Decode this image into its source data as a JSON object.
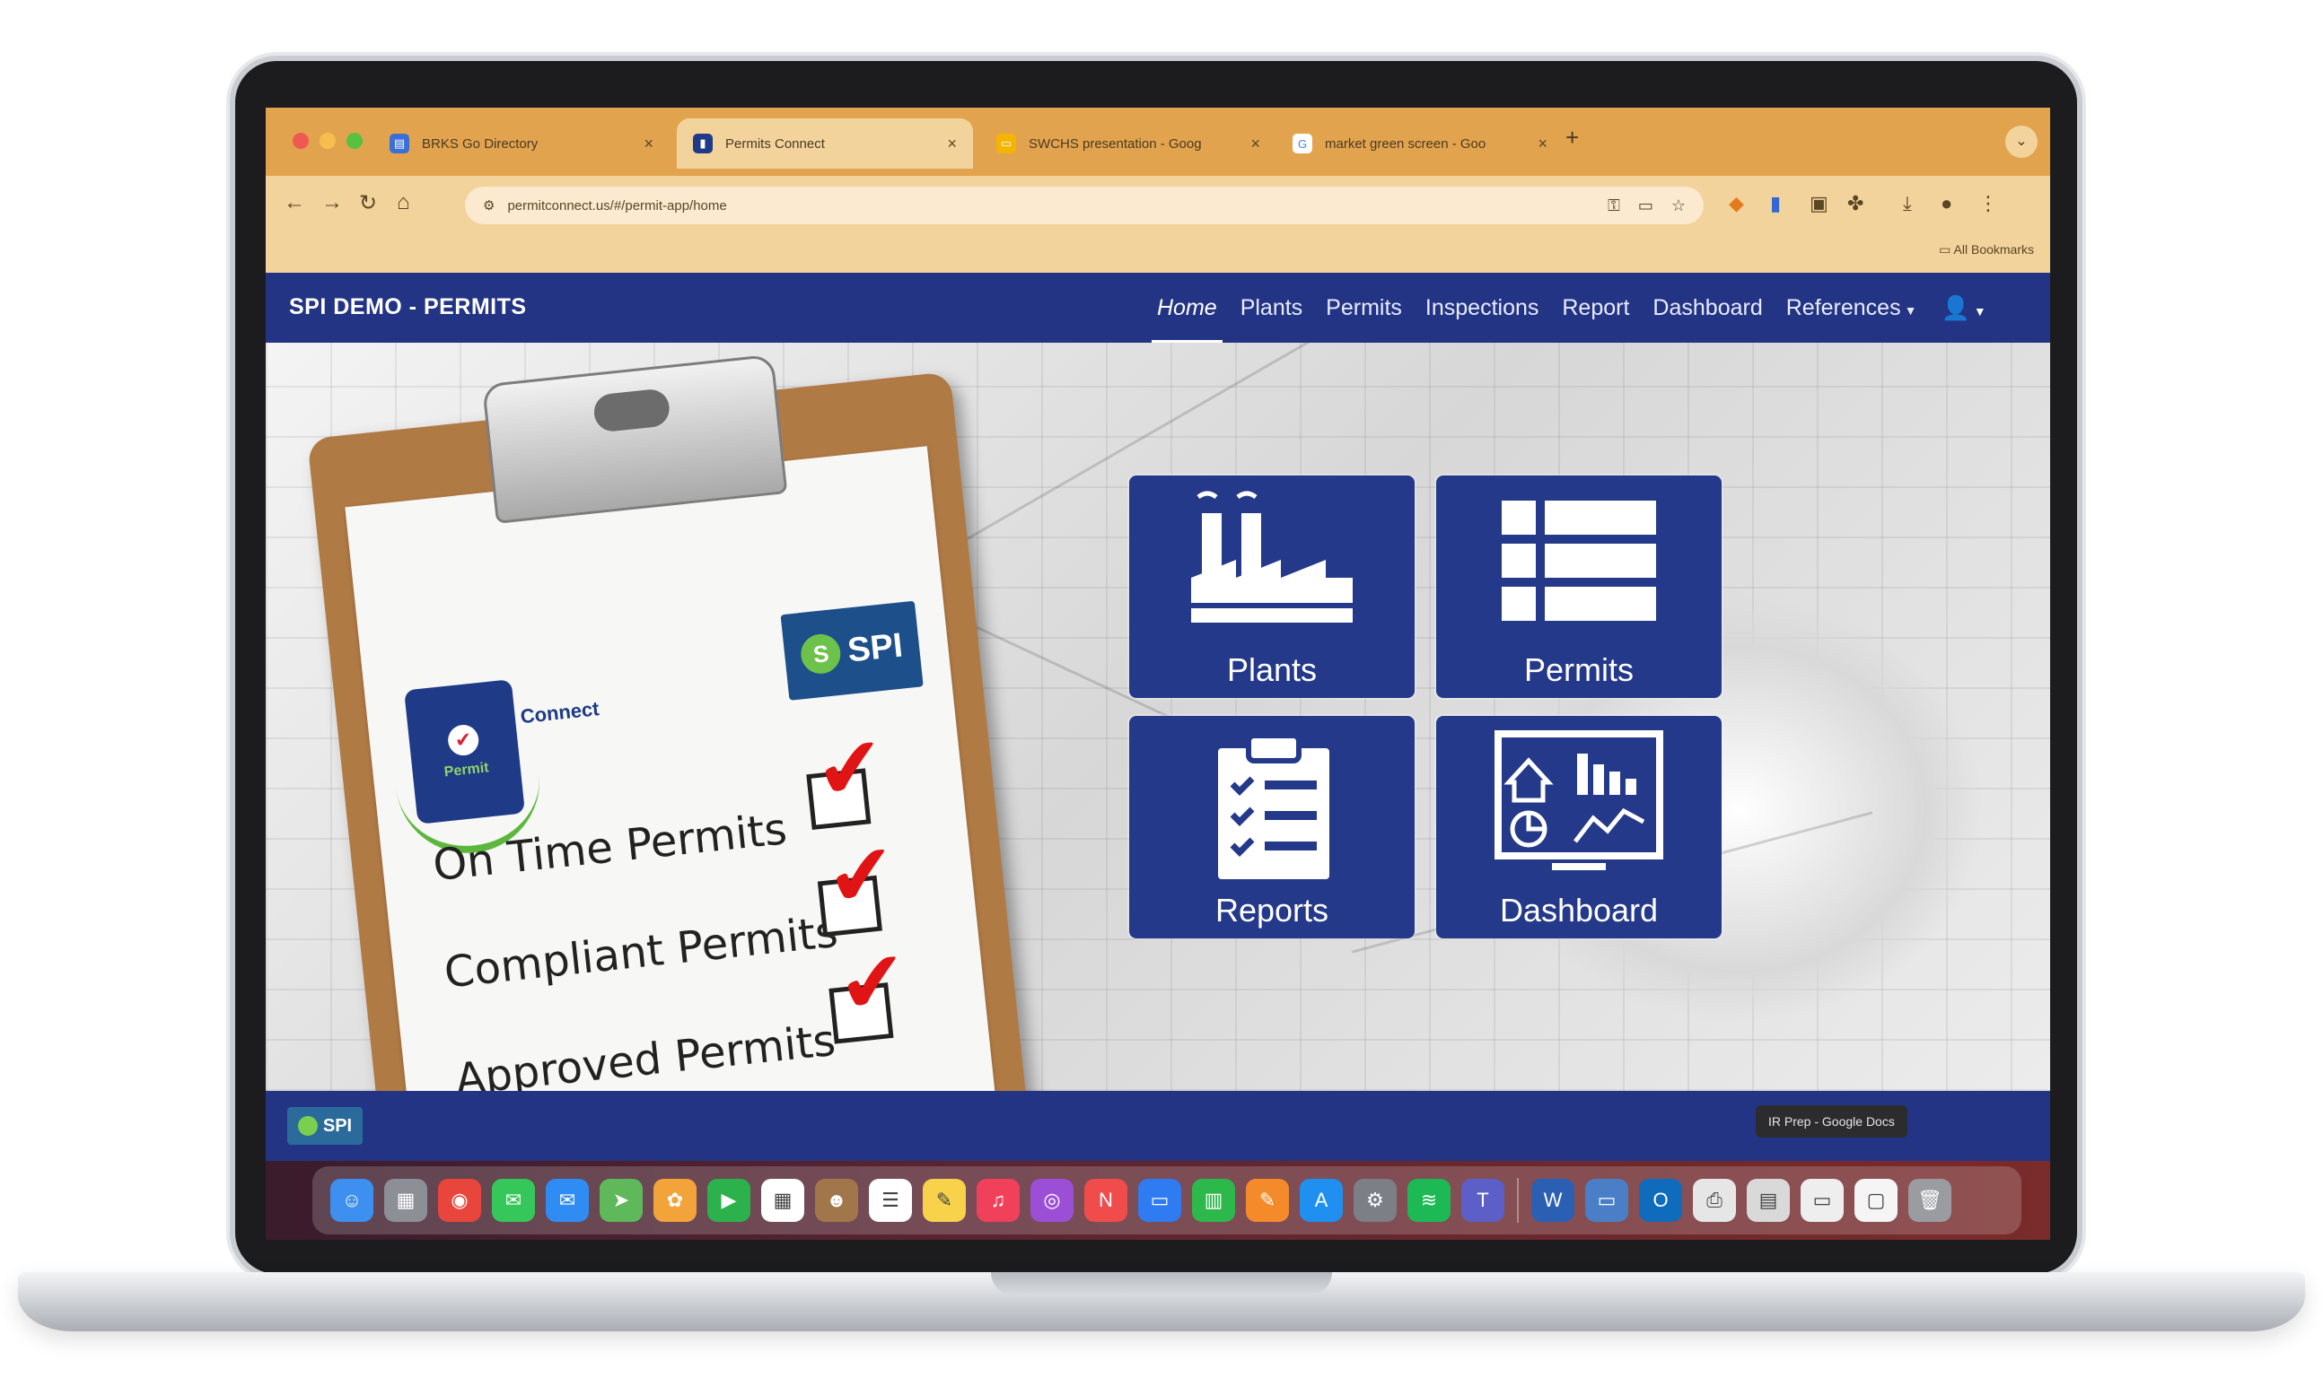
{
  "browser": {
    "tabs": [
      {
        "label": "BRKS Go Directory",
        "color": "#3b6fd6",
        "icon": "doc-icon"
      },
      {
        "label": "Permits Connect",
        "color": "#1f3a86",
        "icon": "permit-icon"
      },
      {
        "label": "SWCHS presentation - Goog",
        "color": "#f4b400",
        "icon": "slides-icon"
      },
      {
        "label": "market green screen - Goo",
        "color": "#ffffff",
        "icon": "google-icon"
      }
    ],
    "url": "permitconnect.us/#/permit-app/home",
    "bookmarks_label": "All Bookmarks"
  },
  "app": {
    "brand": "SPI DEMO - PERMITS",
    "nav": [
      {
        "label": "Home",
        "active": true
      },
      {
        "label": "Plants"
      },
      {
        "label": "Permits"
      },
      {
        "label": "Inspections"
      },
      {
        "label": "Report"
      },
      {
        "label": "Dashboard"
      },
      {
        "label": "References",
        "dropdown": true
      }
    ],
    "user_icon": "user-icon"
  },
  "hero": {
    "clipboard": {
      "logo_left": "Permit",
      "logo_connect": "Connect",
      "logo_right": "SPI",
      "items": [
        "On Time Permits",
        "Compliant Permits",
        "Approved Permits"
      ]
    },
    "tiles": [
      {
        "label": "Plants",
        "icon": "factory-icon"
      },
      {
        "label": "Permits",
        "icon": "list-icon"
      },
      {
        "label": "Reports",
        "icon": "checklist-icon"
      },
      {
        "label": "Dashboard",
        "icon": "monitor-chart-icon"
      }
    ]
  },
  "footer": {
    "logo": "SPI",
    "tooltip": "IR Prep - Google Docs"
  },
  "dock": {
    "apps": [
      {
        "name": "finder-icon",
        "color": "#3d8ff0",
        "glyph": "☺"
      },
      {
        "name": "launchpad-icon",
        "color": "#8d8f96",
        "glyph": "▦"
      },
      {
        "name": "chrome-icon",
        "color": "#e8453c",
        "glyph": "◉"
      },
      {
        "name": "messages-icon",
        "color": "#35c759",
        "glyph": "✉"
      },
      {
        "name": "mail-icon",
        "color": "#2f8cf2",
        "glyph": "✉"
      },
      {
        "name": "maps-icon",
        "color": "#5fb85a",
        "glyph": "➤"
      },
      {
        "name": "photos-icon",
        "color": "#f2a33a",
        "glyph": "✿"
      },
      {
        "name": "facetime-icon",
        "color": "#2bb24c",
        "glyph": "▶"
      },
      {
        "name": "calendar-icon",
        "color": "#ffffff",
        "glyph": "▦"
      },
      {
        "name": "contacts-icon",
        "color": "#a0764a",
        "glyph": "☻"
      },
      {
        "name": "reminders-icon",
        "color": "#ffffff",
        "glyph": "☰"
      },
      {
        "name": "notes-icon",
        "color": "#f7d24a",
        "glyph": "✎"
      },
      {
        "name": "music-icon",
        "color": "#f1405a",
        "glyph": "♫"
      },
      {
        "name": "podcasts-icon",
        "color": "#9b4fd6",
        "glyph": "◎"
      },
      {
        "name": "news-icon",
        "color": "#f14c4c",
        "glyph": "N"
      },
      {
        "name": "keynote-icon",
        "color": "#2f7bf2",
        "glyph": "▭"
      },
      {
        "name": "numbers-icon",
        "color": "#2cb84a",
        "glyph": "▥"
      },
      {
        "name": "pages-icon",
        "color": "#f48a2a",
        "glyph": "✎"
      },
      {
        "name": "app-store-icon",
        "color": "#1f8ff0",
        "glyph": "A"
      },
      {
        "name": "settings-icon",
        "color": "#7d7f86",
        "glyph": "⚙"
      },
      {
        "name": "spotify-icon",
        "color": "#1db954",
        "glyph": "≋"
      },
      {
        "name": "teams-icon",
        "color": "#5b5fc7",
        "glyph": "T"
      },
      {
        "name": "word-icon",
        "color": "#2b5fb3",
        "glyph": "W"
      },
      {
        "name": "remote-desktop-icon",
        "color": "#4a7fc7",
        "glyph": "▭"
      },
      {
        "name": "outlook-icon",
        "color": "#0f6cbd",
        "glyph": "O"
      },
      {
        "name": "printer-icon",
        "color": "#e6e6e6",
        "glyph": "⎙"
      },
      {
        "name": "preview-icon",
        "color": "#d9d9d9",
        "glyph": "▤"
      },
      {
        "name": "downloads-icon",
        "color": "#eeeeee",
        "glyph": "▭"
      },
      {
        "name": "document-icon",
        "color": "#f5f5f5",
        "glyph": "▢"
      },
      {
        "name": "trash-icon",
        "color": "#9a9ca1",
        "glyph": "🗑"
      }
    ]
  }
}
